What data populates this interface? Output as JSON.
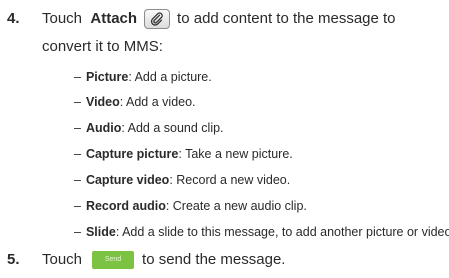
{
  "step4": {
    "number": "4.",
    "touch": "Touch",
    "attach_label": "Attach",
    "attach_icon": "paperclip-icon",
    "rest_line1": "to add content to the message to",
    "line2": "convert it to MMS:"
  },
  "bullets": [
    {
      "dash": "–",
      "term": "Picture",
      "desc": ": Add a picture."
    },
    {
      "dash": "–",
      "term": "Video",
      "desc": ": Add a video."
    },
    {
      "dash": "–",
      "term": "Audio",
      "desc": ": Add a sound clip."
    },
    {
      "dash": "–",
      "term": "Capture picture",
      "desc": ": Take a new picture."
    },
    {
      "dash": "–",
      "term": "Capture video",
      "desc": ": Record a new video."
    },
    {
      "dash": "–",
      "term": "Record audio",
      "desc": ": Create a new audio clip."
    },
    {
      "dash": "–",
      "term": "Slide",
      "desc": ": Add a slide to this message, to add another picture or video."
    }
  ],
  "step5": {
    "number": "5.",
    "touch": "Touch",
    "send_label": "Send",
    "rest": "to send the message."
  },
  "colors": {
    "send_button": "#7cc243",
    "text": "#2a2a2a"
  }
}
